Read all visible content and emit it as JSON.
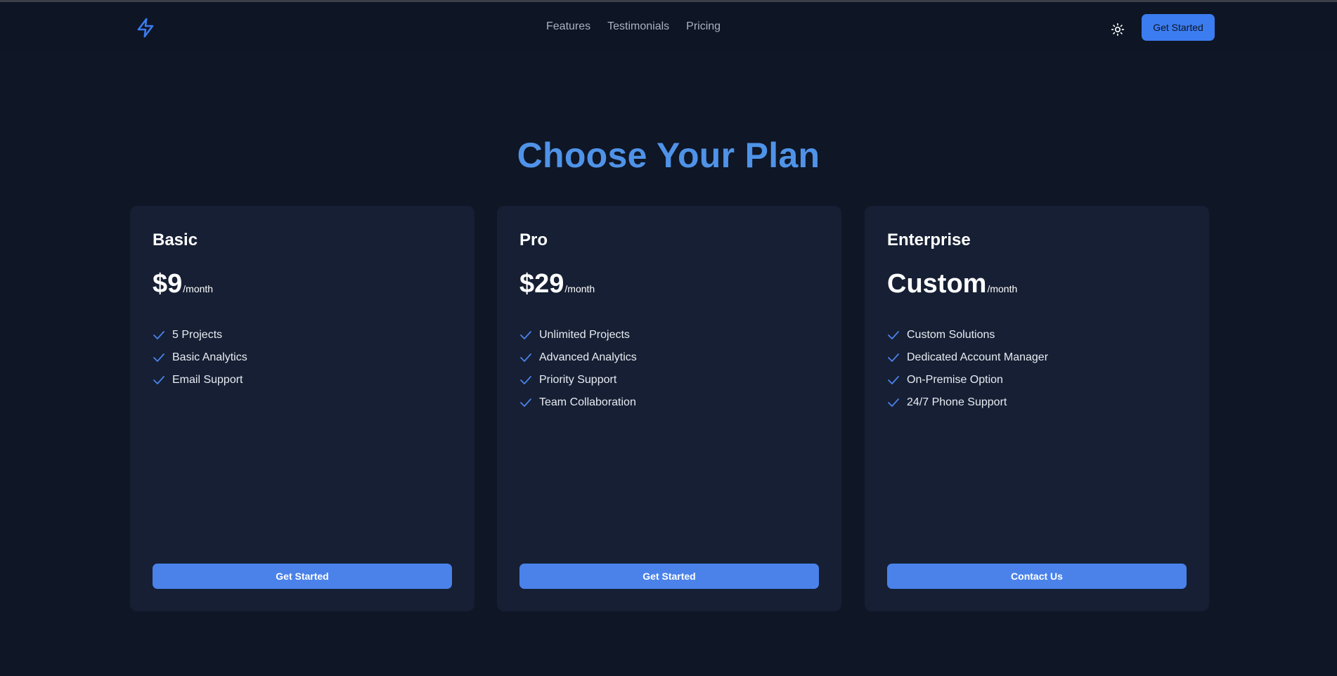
{
  "nav": {
    "links": [
      "Features",
      "Testimonials",
      "Pricing"
    ],
    "cta_label": "Get Started",
    "logo_icon": "lightning-bolt-icon",
    "theme_icon": "sun-icon"
  },
  "heading": "Choose Your Plan",
  "plans": [
    {
      "name": "Basic",
      "price": "$9",
      "period": "/month",
      "features": [
        "5 Projects",
        "Basic Analytics",
        "Email Support"
      ],
      "button_label": "Get Started"
    },
    {
      "name": "Pro",
      "price": "$29",
      "period": "/month",
      "features": [
        "Unlimited Projects",
        "Advanced Analytics",
        "Priority Support",
        "Team Collaboration"
      ],
      "button_label": "Get Started"
    },
    {
      "name": "Enterprise",
      "price": "Custom",
      "period": "/month",
      "features": [
        "Custom Solutions",
        "Dedicated Account Manager",
        "On-Premise Option",
        "24/7 Phone Support"
      ],
      "button_label": "Contact Us"
    }
  ],
  "colors": {
    "background": "#0f1626",
    "card": "#161f33",
    "accent": "#4a82ea",
    "heading": "#4f93e8"
  }
}
